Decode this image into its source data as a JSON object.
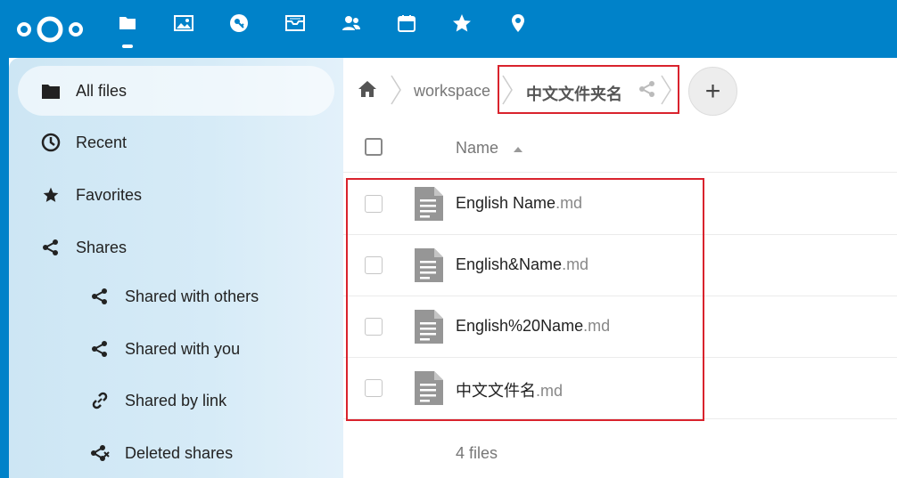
{
  "header": {
    "apps": [
      {
        "name": "files-icon",
        "active": true
      },
      {
        "name": "photos-icon",
        "active": false
      },
      {
        "name": "passwords-icon",
        "active": false
      },
      {
        "name": "mail-icon",
        "active": false
      },
      {
        "name": "contacts-icon",
        "active": false
      },
      {
        "name": "calendar-icon",
        "active": false
      },
      {
        "name": "favorites-star-icon",
        "active": false
      },
      {
        "name": "maps-icon",
        "active": false
      }
    ]
  },
  "sidebar": {
    "items": [
      {
        "label": "All files",
        "icon": "folder-icon"
      },
      {
        "label": "Recent",
        "icon": "clock-icon"
      },
      {
        "label": "Favorites",
        "icon": "star-icon"
      },
      {
        "label": "Shares",
        "icon": "share-icon"
      },
      {
        "label": "Shared with others",
        "icon": "share-icon"
      },
      {
        "label": "Shared with you",
        "icon": "share-icon"
      },
      {
        "label": "Shared by link",
        "icon": "link-icon"
      },
      {
        "label": "Deleted shares",
        "icon": "deleted-share-icon"
      }
    ]
  },
  "breadcrumb": {
    "items": [
      "workspace",
      "中文文件夹名"
    ]
  },
  "new_button_label": "+",
  "file_list": {
    "column_name": "Name",
    "files": [
      {
        "base": "English Name",
        "ext": ".md"
      },
      {
        "base": "English&Name",
        "ext": ".md"
      },
      {
        "base": "English%20Name",
        "ext": ".md"
      },
      {
        "base": "中文文件名",
        "ext": ".md"
      }
    ],
    "summary": "4 files"
  },
  "colors": {
    "brand": "#0082c9",
    "highlight": "#d9232d"
  }
}
